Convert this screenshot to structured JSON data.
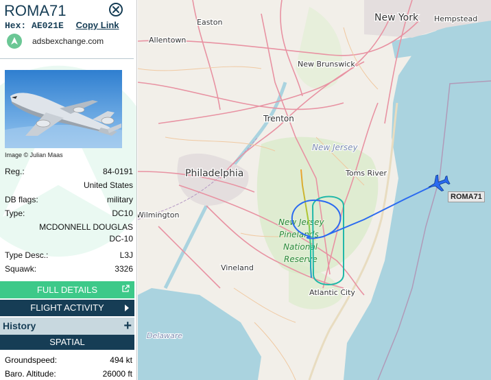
{
  "aircraft": {
    "callsign": "ROMA71",
    "hex_label": "Hex:",
    "hex": "AE021E",
    "copy_link": "Copy Link",
    "source": "adsbexchange.com",
    "photo_credit": "Image © Julian Maas"
  },
  "details": [
    {
      "label": "Reg.:",
      "value": "84-0191"
    },
    {
      "label": "",
      "value": "United States"
    },
    {
      "label": "DB flags:",
      "value": "military"
    },
    {
      "label": "Type:",
      "value": "DC10"
    },
    {
      "label": "",
      "value": "MCDONNELL DOUGLAS"
    },
    {
      "label": "",
      "value": "DC-10"
    },
    {
      "label": "Type Desc.:",
      "value": "L3J"
    },
    {
      "label": "Squawk:",
      "value": "3326"
    }
  ],
  "buttons": {
    "full_details": "FULL DETAILS",
    "flight_activity": "FLIGHT ACTIVITY",
    "history": "History",
    "history_plus": "+",
    "spatial": "SPATIAL"
  },
  "spatial": [
    {
      "label": "Groundspeed:",
      "value": "494 kt"
    },
    {
      "label": "Baro. Altitude:",
      "value": "26000 ft"
    }
  ],
  "map": {
    "cities": {
      "new_york": "New York",
      "hempstead": "Hempstead",
      "easton": "Easton",
      "allentown": "Allentown",
      "new_brunswick": "New Brunswick",
      "trenton": "Trenton",
      "new_jersey": "New Jersey",
      "toms_river": "Toms River",
      "philadelphia": "Philadelphia",
      "wilmington": "Wilmington",
      "vineland": "Vineland",
      "atlantic_city": "Atlantic City",
      "delaware": "Delaware",
      "park_1": "New Jersey",
      "park_2": "Pinelands",
      "park_3": "National",
      "park_4": "Reserve"
    },
    "aircraft_label": "ROMA71"
  },
  "colors": {
    "navy": "#163d55",
    "green": "#3dc989",
    "water": "#aad3df",
    "land": "#f2efe9",
    "track_blue": "#2a6af0"
  }
}
